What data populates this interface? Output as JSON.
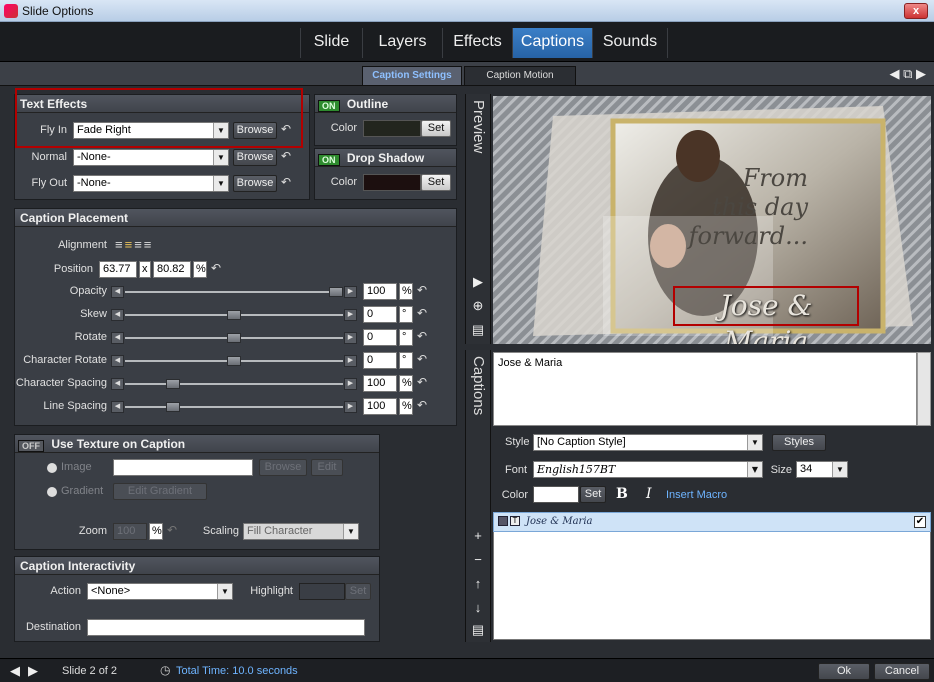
{
  "window": {
    "title": "Slide Options",
    "close_label": "x"
  },
  "main_tabs": [
    {
      "label": "Slide",
      "active": false
    },
    {
      "label": "Layers",
      "active": false
    },
    {
      "label": "Effects",
      "active": false
    },
    {
      "label": "Captions",
      "active": true
    },
    {
      "label": "Sounds",
      "active": false
    }
  ],
  "sub_tabs": [
    {
      "label": "Caption Settings",
      "active": true
    },
    {
      "label": "Caption Motion",
      "active": false
    }
  ],
  "text_effects": {
    "title": "Text Effects",
    "rows": [
      {
        "label": "Fly In",
        "value": "Fade Right",
        "button": "Browse"
      },
      {
        "label": "Normal",
        "value": "-None-",
        "button": "Browse"
      },
      {
        "label": "Fly Out",
        "value": "-None-",
        "button": "Browse"
      }
    ]
  },
  "outline": {
    "toggle": "ON",
    "title": "Outline",
    "color_label": "Color",
    "set_label": "Set",
    "color": "#22251e"
  },
  "drop_shadow": {
    "toggle": "ON",
    "title": "Drop Shadow",
    "color_label": "Color",
    "set_label": "Set",
    "color": "#1c0f0f"
  },
  "placement": {
    "title": "Caption Placement",
    "alignment_label": "Alignment",
    "position_label": "Position",
    "position_x": "63.77",
    "position_sep": "x",
    "position_y": "80.82",
    "position_unit": "%",
    "sliders": [
      {
        "label": "Opacity",
        "value": "100",
        "unit": "%",
        "level": 1.0
      },
      {
        "label": "Skew",
        "value": "0",
        "unit": "°",
        "level": 0.5
      },
      {
        "label": "Rotate",
        "value": "0",
        "unit": "°",
        "level": 0.5
      },
      {
        "label": "Character Rotate",
        "value": "0",
        "unit": "°",
        "level": 0.5
      },
      {
        "label": "Character Spacing",
        "value": "100",
        "unit": "%",
        "level": 0.2
      },
      {
        "label": "Line Spacing",
        "value": "100",
        "unit": "%",
        "level": 0.2
      }
    ]
  },
  "texture": {
    "toggle": "OFF",
    "title": "Use Texture on Caption",
    "image_label": "Image",
    "gradient_label": "Gradient",
    "browse_label": "Browse",
    "edit_label": "Edit",
    "edit_gradient_label": "Edit Gradient",
    "zoom_label": "Zoom",
    "zoom_value": "100",
    "zoom_unit": "%",
    "scaling_label": "Scaling",
    "scaling_value": "Fill Character"
  },
  "interactivity": {
    "title": "Caption Interactivity",
    "action_label": "Action",
    "action_value": "<None>",
    "highlight_label": "Highlight",
    "set_label": "Set",
    "destination_label": "Destination",
    "destination_value": ""
  },
  "preview": {
    "side_label": "Preview",
    "script_lines": [
      "From",
      "this day",
      "forward..."
    ],
    "caption_text": "Jose & Maria"
  },
  "captions": {
    "side_label": "Captions",
    "text": "Jose & Maria",
    "style_label": "Style",
    "style_value": "[No Caption Style]",
    "styles_button": "Styles",
    "font_label": "Font",
    "font_value": "English157BT",
    "size_label": "Size",
    "size_value": "34",
    "color_label": "Color",
    "set_label": "Set",
    "bold_label": "B",
    "italic_label": "I",
    "insert_macro_label": "Insert Macro",
    "list_item": "Jose & Maria",
    "list_item_checked": true
  },
  "status": {
    "slide_text": "Slide 2 of 2",
    "total_time": "Total Time: 10.0 seconds",
    "ok_label": "Ok",
    "cancel_label": "Cancel"
  }
}
